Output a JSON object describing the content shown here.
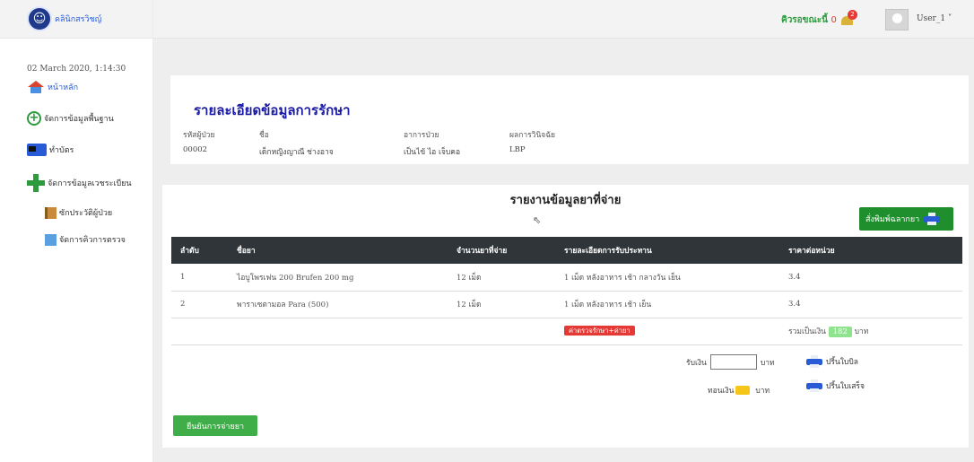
{
  "brand": {
    "name": "คลินิกสรวิชญ์"
  },
  "sidebar": {
    "datetime": "02 March 2020, 1:14:30",
    "items": [
      {
        "label": "หน้าหลัก"
      },
      {
        "label": "จัดการข้อมูลพื้นฐาน"
      },
      {
        "label": "ทำบัตร"
      },
      {
        "label": "จัดการข้อมูลเวชระเบียน"
      },
      {
        "label": "ซักประวัติผู้ป่วย"
      },
      {
        "label": "จัดการคิวการตรวจ"
      }
    ]
  },
  "topbar": {
    "queue_label": "คิวรอขณะนี้",
    "queue_count": "0",
    "notif_count": "2",
    "user": "User_1 ˅"
  },
  "detail": {
    "title": "รายละเอียดข้อมูลการรักษา",
    "fields": [
      {
        "label": "รหัสผู้ป่วย",
        "value": "00002"
      },
      {
        "label": "ชื่อ",
        "value": "เด็กหญิงญาณี ช่างอาจ"
      },
      {
        "label": "อาการป่วย",
        "value": "เป็นไข้ ไอ เจ็บคอ"
      },
      {
        "label": "ผลการวินิจฉัย",
        "value": "LBP"
      }
    ]
  },
  "report": {
    "title": "รายงานข้อมูลยาที่จ่าย",
    "print_label": "สั่งพิมพ์ฉลากยา",
    "columns": [
      "ลำดับ",
      "ชื่อยา",
      "จำนวนยาที่จ่าย",
      "รายละเอียดการรับประทาน",
      "ราคาต่อหน่วย"
    ],
    "rows": [
      [
        "1",
        "ไอบูโพรเฟน 200 Brufen 200 mg",
        "12 เม็ด",
        "1 เม็ด หลังอาหาร เช้า กลางวัน เย็น",
        "3.4"
      ],
      [
        "2",
        "พาราเซตามอล Para (500)",
        "12 เม็ด",
        "1 เม็ด หลังอาหาร เช้า เย็น",
        "3.4"
      ]
    ],
    "fee_badge": "ค่าตรวจรักษา+ค่ายา",
    "total_label": "รวมเป็นเงิน",
    "total_value": "182",
    "baht": "บาท"
  },
  "payment": {
    "receive_label": "รับเงิน",
    "receive_value": "",
    "change_label": "ทอนเงิน",
    "baht": "บาท",
    "print_bill": "ปริ้นใบบิล",
    "print_receipt": "ปริ้นใบเสร็จ",
    "confirm": "ยืนยันการจ่ายยา"
  }
}
